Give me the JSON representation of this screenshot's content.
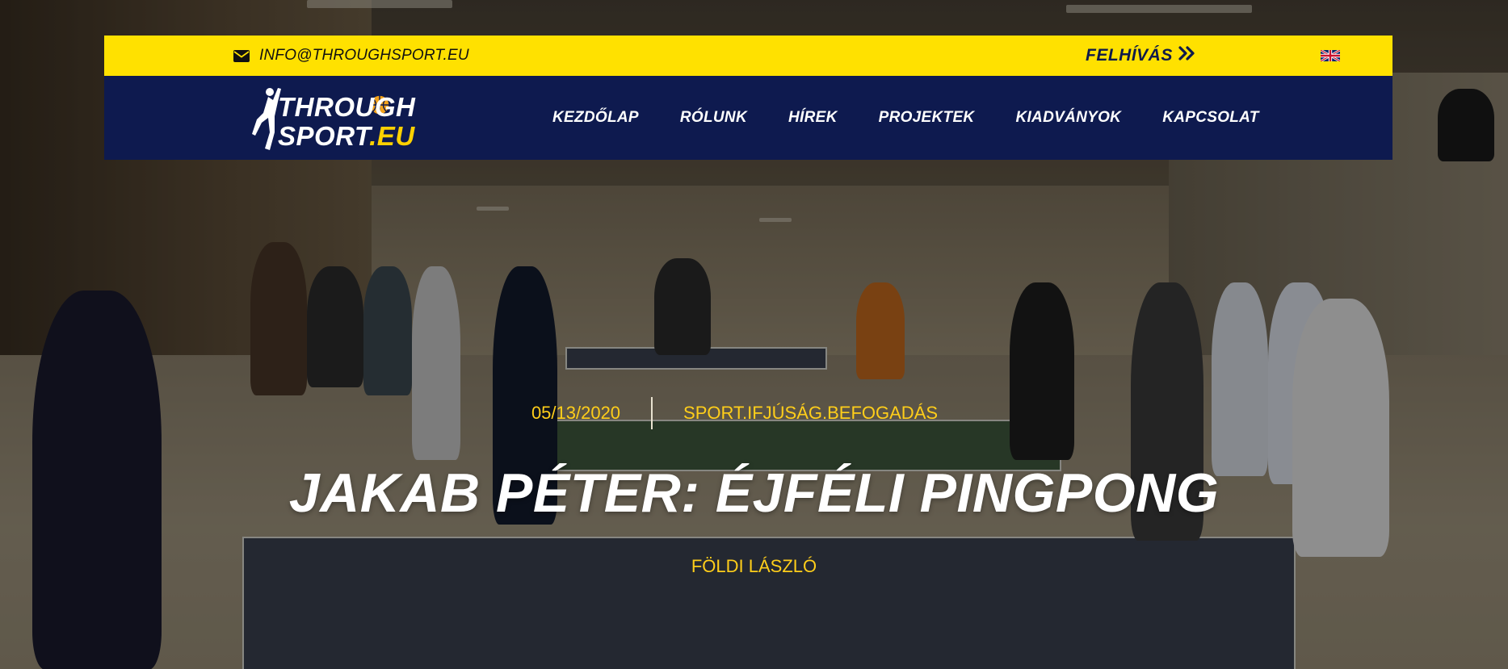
{
  "topbar": {
    "email": "INFO@THROUGHSPORT.EU",
    "call_label": "FELHÍVÁS",
    "call_icon": "double-chevron-right-icon",
    "email_icon": "envelope-icon",
    "language_icon": "uk-flag-icon"
  },
  "brand": {
    "line1": "THROUGH",
    "line2": "SPORT",
    "line2_suffix": ".EU",
    "colors": {
      "navy": "#0e1a4f",
      "yellow": "#ffe100"
    }
  },
  "nav": {
    "items": [
      {
        "label": "KEZDŐLAP"
      },
      {
        "label": "RÓLUNK"
      },
      {
        "label": "HÍREK"
      },
      {
        "label": "PROJEKTEK"
      },
      {
        "label": "KIADVÁNYOK"
      },
      {
        "label": "KAPCSOLAT"
      }
    ]
  },
  "article": {
    "date": "05/13/2020",
    "tags": "SPORT.IFJÚSÁG.BEFOGADÁS",
    "title": "JAKAB PÉTER: ÉJFÉLI PINGPONG",
    "author": "FÖLDI LÁSZLÓ",
    "accent_color": "#ffce1a"
  }
}
